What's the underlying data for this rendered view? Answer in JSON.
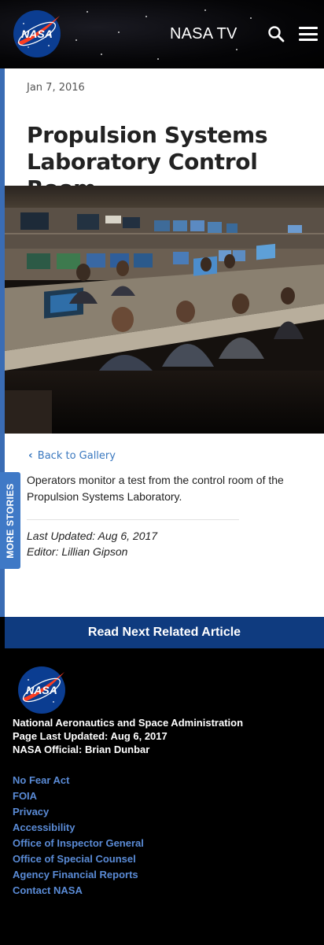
{
  "header": {
    "logo_text": "NASA",
    "tv_label": "NASA TV",
    "search_icon": "search-icon",
    "menu_icon": "hamburger-menu-icon"
  },
  "sidebar": {
    "more_stories": "MORE STORIES"
  },
  "article": {
    "date": "Jan 7, 2016",
    "title": "Propulsion Systems Laboratory Control Room",
    "back_link": "Back to Gallery",
    "caption": "Operators monitor a test from the control room of the Propulsion Systems Laboratory.",
    "last_updated": "Last Updated: Aug 6, 2017",
    "editor": "Editor: Lillian Gipson"
  },
  "read_next": "Read Next Related Article",
  "footer": {
    "agency": "National Aeronautics and Space Administration",
    "page_updated": "Page Last Updated: Aug 6, 2017",
    "official": "NASA Official: Brian Dunbar",
    "links": [
      "No Fear Act",
      "FOIA",
      "Privacy",
      "Accessibility",
      "Office of Inspector General",
      "Office of Special Counsel",
      "Agency Financial Reports",
      "Contact NASA"
    ]
  },
  "colors": {
    "header_bg": "#000000",
    "accent_blue": "#3a78bf",
    "read_next_bg": "#0f3b7f",
    "footer_link": "#5a8bd6",
    "nasa_blue": "#0b3d91",
    "nasa_red": "#fc3d21"
  }
}
